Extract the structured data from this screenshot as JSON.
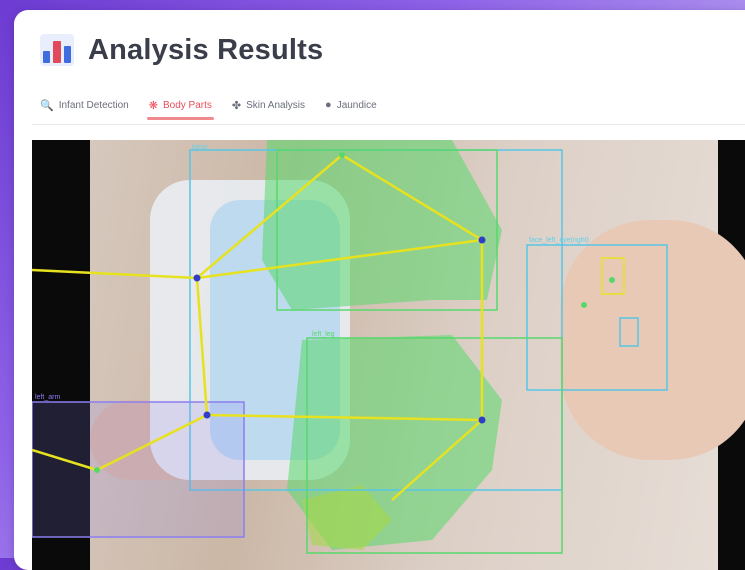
{
  "header": {
    "title": "Analysis Results",
    "icon": "bar-chart-icon"
  },
  "tabs": [
    {
      "label": "Infant Detection",
      "icon": "magnifier-icon",
      "active": false
    },
    {
      "label": "Body Parts",
      "icon": "body-parts-icon",
      "active": true
    },
    {
      "label": "Skin Analysis",
      "icon": "skin-analysis-icon",
      "active": false
    },
    {
      "label": "Jaundice",
      "icon": "jaundice-icon",
      "active": false
    }
  ],
  "viewer": {
    "box_labels": {
      "torso": "torso",
      "face": "face_left_eye(right)",
      "left_leg": "left_leg",
      "left_arm": "left_arm"
    }
  },
  "colors": {
    "accent": "#ea4d5a",
    "tab_underline": "#f08a8f",
    "title": "#3a3d4a",
    "skeleton": "#e7e21f",
    "box_blue": "#57c6e6",
    "box_purple": "#8b7ef0",
    "segment_green": "#58d86b"
  }
}
